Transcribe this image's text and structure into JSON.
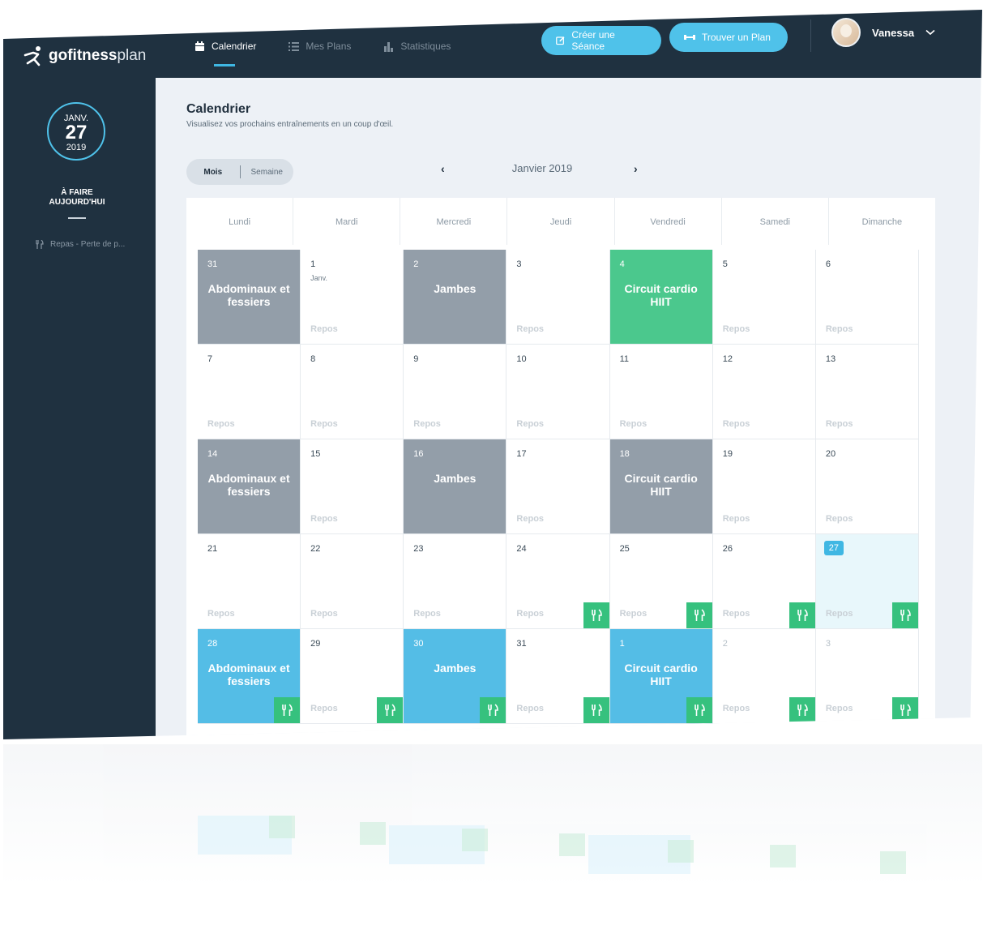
{
  "app": {
    "logo_bold": "gofitness",
    "logo_light": "plan"
  },
  "nav": [
    {
      "label": "Calendrier",
      "icon": "calendar-icon",
      "active": true
    },
    {
      "label": "Mes Plans",
      "icon": "list-icon",
      "active": false
    },
    {
      "label": "Statistiques",
      "icon": "bar-chart-icon",
      "active": false
    }
  ],
  "actions": {
    "create_label": "Créer une Séance",
    "find_label": "Trouver un Plan"
  },
  "user": {
    "name": "Vanessa"
  },
  "sidebar": {
    "month": "JANV.",
    "day": "27",
    "year": "2019",
    "todo_title": "À FAIRE AUJOURD'HUI",
    "todo_item": "Repas - Perte de p..."
  },
  "page": {
    "title": "Calendrier",
    "subtitle": "Visualisez vos prochains entraînements en un coup d'œil."
  },
  "view_toggle": {
    "month": "Mois",
    "week": "Semaine"
  },
  "month_nav": {
    "label": "Janvier 2019"
  },
  "weekdays": [
    "Lundi",
    "Mardi",
    "Mercredi",
    "Jeudi",
    "Vendredi",
    "Samedi",
    "Dimanche"
  ],
  "rest_label": "Repos",
  "colors": {
    "nav_bg": "#1f3140",
    "accent_blue": "#4fc2ea",
    "done_gray": "#939ea9",
    "cardio_green": "#4bc88d",
    "meal_green": "#36c17e"
  },
  "days": [
    {
      "num": "31",
      "style": "gray",
      "workout": "Abdominaux et fessiers"
    },
    {
      "num": "1",
      "sub": "Janv.",
      "rest": true
    },
    {
      "num": "2",
      "style": "gray",
      "workout": "Jambes"
    },
    {
      "num": "3",
      "rest": true
    },
    {
      "num": "4",
      "style": "green",
      "workout": "Circuit cardio HIIT"
    },
    {
      "num": "5",
      "rest": true
    },
    {
      "num": "6",
      "rest": true
    },
    {
      "num": "7",
      "rest": true
    },
    {
      "num": "8",
      "rest": true
    },
    {
      "num": "9",
      "rest": true
    },
    {
      "num": "10",
      "rest": true
    },
    {
      "num": "11",
      "rest": true
    },
    {
      "num": "12",
      "rest": true
    },
    {
      "num": "13",
      "rest": true
    },
    {
      "num": "14",
      "style": "gray",
      "workout": "Abdominaux et fessiers"
    },
    {
      "num": "15",
      "rest": true
    },
    {
      "num": "16",
      "style": "gray",
      "workout": "Jambes"
    },
    {
      "num": "17",
      "rest": true
    },
    {
      "num": "18",
      "style": "gray",
      "workout": "Circuit cardio HIIT"
    },
    {
      "num": "19",
      "rest": true
    },
    {
      "num": "20",
      "rest": true
    },
    {
      "num": "21",
      "rest": true
    },
    {
      "num": "22",
      "rest": true
    },
    {
      "num": "23",
      "rest": true
    },
    {
      "num": "24",
      "rest": true,
      "meal": true
    },
    {
      "num": "25",
      "rest": true,
      "meal": true
    },
    {
      "num": "26",
      "rest": true,
      "meal": true
    },
    {
      "num": "27",
      "today": true,
      "rest": true,
      "meal": true
    },
    {
      "num": "28",
      "style": "blue",
      "workout": "Abdominaux et fessiers",
      "meal": true
    },
    {
      "num": "29",
      "rest": true,
      "meal": true
    },
    {
      "num": "30",
      "style": "blue",
      "workout": "Jambes",
      "meal": true
    },
    {
      "num": "31",
      "rest": true,
      "meal": true
    },
    {
      "num": "1",
      "style": "blue",
      "workout": "Circuit cardio HIIT",
      "meal": true
    },
    {
      "num": "2",
      "other": true,
      "rest": true,
      "meal": true
    },
    {
      "num": "3",
      "other": true,
      "rest": true,
      "meal": true
    }
  ]
}
